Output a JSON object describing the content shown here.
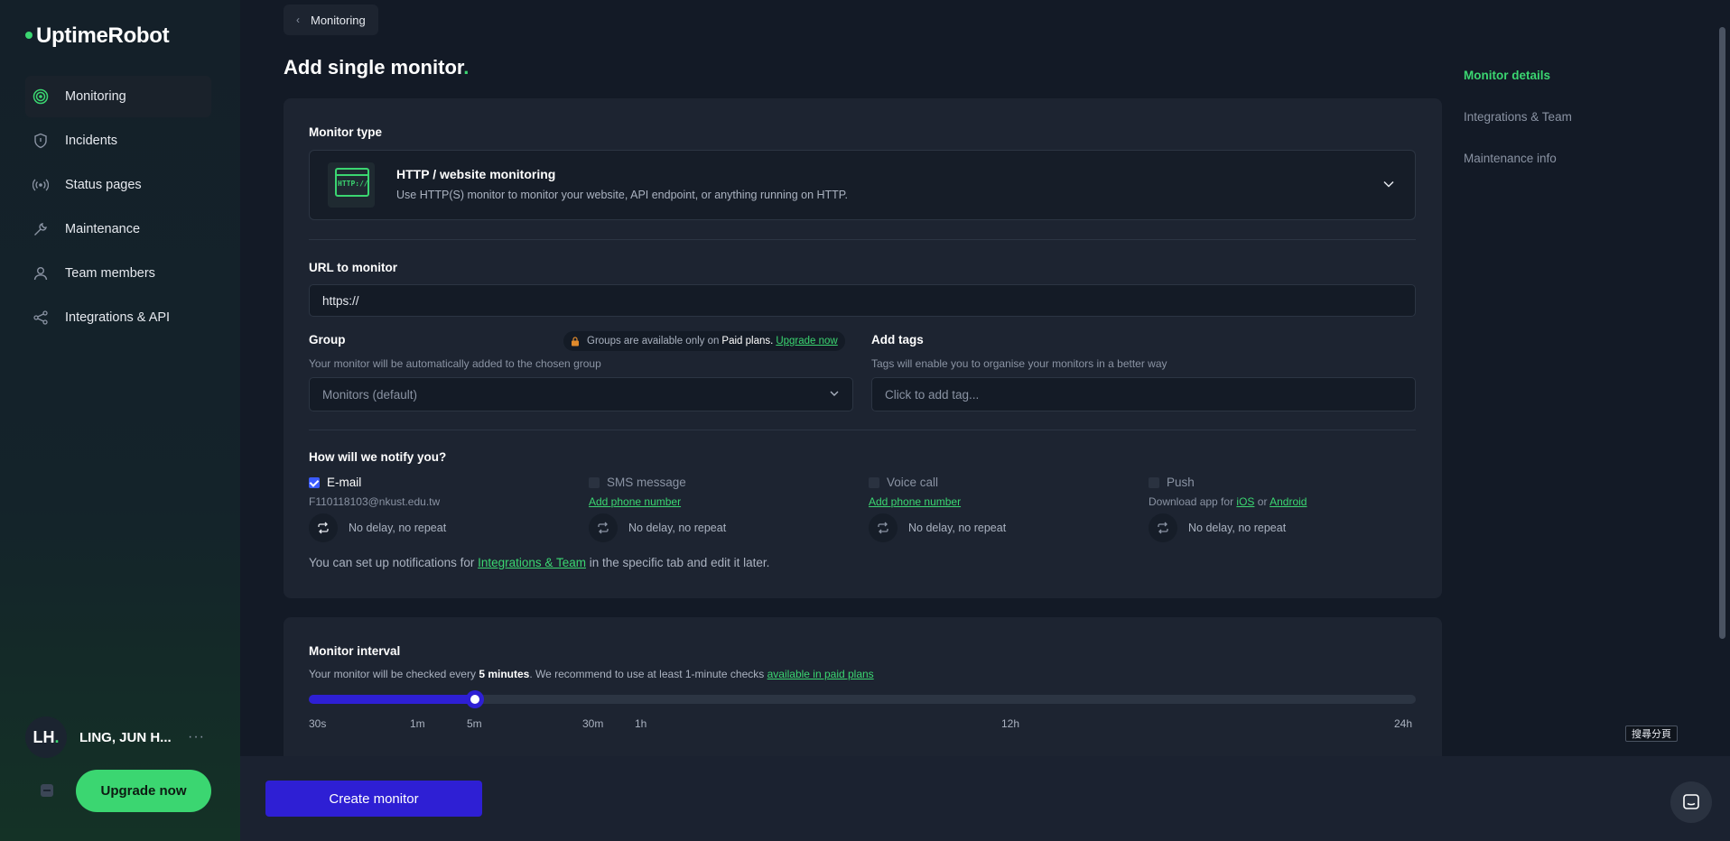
{
  "app": {
    "name": "UptimeRobot"
  },
  "sidebar": {
    "items": [
      {
        "label": "Monitoring",
        "icon": "target-icon",
        "active": true
      },
      {
        "label": "Incidents",
        "icon": "shield-icon",
        "active": false
      },
      {
        "label": "Status pages",
        "icon": "broadcast-icon",
        "active": false
      },
      {
        "label": "Maintenance",
        "icon": "wrench-icon",
        "active": false
      },
      {
        "label": "Team members",
        "icon": "user-icon",
        "active": false
      },
      {
        "label": "Integrations & API",
        "icon": "share-icon",
        "active": false
      }
    ],
    "user": {
      "initials": "LH",
      "name": "LING, JUN H...",
      "more": "···"
    },
    "upgrade_label": "Upgrade now"
  },
  "header": {
    "back_label": "Monitoring",
    "title": "Add single monitor"
  },
  "monitor_type": {
    "label": "Monitor type",
    "icon_text": "HTTP://",
    "title": "HTTP / website monitoring",
    "description": "Use HTTP(S) monitor to monitor your website, API endpoint, or anything running on HTTP."
  },
  "url": {
    "label": "URL to monitor",
    "value": "https://"
  },
  "group": {
    "label": "Group",
    "sub": "Your monitor will be automatically added to the chosen group",
    "value": "Monitors (default)",
    "paid_text_1": "Groups are available only on",
    "paid_bold": "Paid plans.",
    "paid_link": "Upgrade now"
  },
  "tags": {
    "label": "Add tags",
    "sub": "Tags will enable you to organise your monitors in a better way",
    "placeholder": "Click to add tag..."
  },
  "notify": {
    "label": "How will we notify you?",
    "channels": [
      {
        "label": "E-mail",
        "checked": true,
        "sub": "F110118103@nkust.edu.tw",
        "repeat": "No delay, no repeat"
      },
      {
        "label": "SMS message",
        "checked": false,
        "link": "Add phone number",
        "repeat": "No delay, no repeat"
      },
      {
        "label": "Voice call",
        "checked": false,
        "link": "Add phone number",
        "repeat": "No delay, no repeat"
      },
      {
        "label": "Push",
        "checked": false,
        "sub_prefix": "Download app for",
        "ios": "iOS",
        "or": "or",
        "android": "Android",
        "repeat": "No delay, no repeat"
      }
    ],
    "note_prefix": "You can set up notifications for",
    "note_link": "Integrations & Team",
    "note_suffix": "in the specific tab and edit it later."
  },
  "interval": {
    "label": "Monitor interval",
    "sub_prefix": "Your monitor will be checked every",
    "sub_bold": "5 minutes",
    "sub_mid": ". We recommend to use at least 1-minute checks",
    "sub_link": "available in paid plans",
    "value_fraction": 0.15,
    "ticks": [
      "30s",
      "1m",
      "5m",
      "30m",
      "1h",
      "12h",
      "24h"
    ]
  },
  "footer": {
    "create_label": "Create monitor"
  },
  "right_nav": {
    "items": [
      {
        "label": "Monitor details",
        "active": true
      },
      {
        "label": "Integrations & Team",
        "active": false
      },
      {
        "label": "Maintenance info",
        "active": false
      }
    ]
  },
  "extension_tag": "搜尋分頁",
  "colors": {
    "accent": "#3bd671",
    "primary": "#2e1fd4",
    "background": "#131a26",
    "card": "#1d2431"
  }
}
